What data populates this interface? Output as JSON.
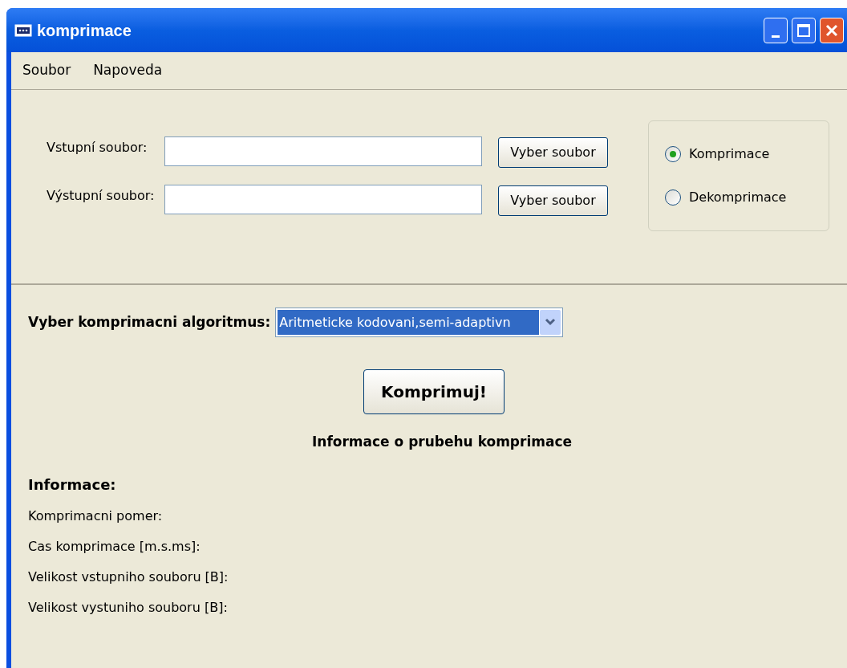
{
  "window": {
    "title": "komprimace"
  },
  "menu": [
    "Soubor",
    "Napoveda"
  ],
  "files": [
    {
      "label": "Vstupní soubor:",
      "button": "Vyber soubor"
    },
    {
      "label": "Výstupní soubor:",
      "button": "Vyber soubor"
    }
  ],
  "mode": [
    {
      "label": "Komprimace",
      "selected": true
    },
    {
      "label": "Dekomprimace",
      "selected": false
    }
  ],
  "algorithm": {
    "label": "Vyber komprimacni algoritmus:",
    "value": "Aritmeticke kodovani,semi-adaptivn"
  },
  "run_button": "Komprimuj!",
  "progress_heading": "Informace o prubehu komprimace",
  "info": {
    "heading": "Informace:",
    "rows": [
      "Komprimacni pomer:",
      "Cas komprimace [m.s.ms]:",
      "Velikost vstupniho souboru [B]:",
      "Velikost vystuniho souboru [B]:"
    ]
  }
}
